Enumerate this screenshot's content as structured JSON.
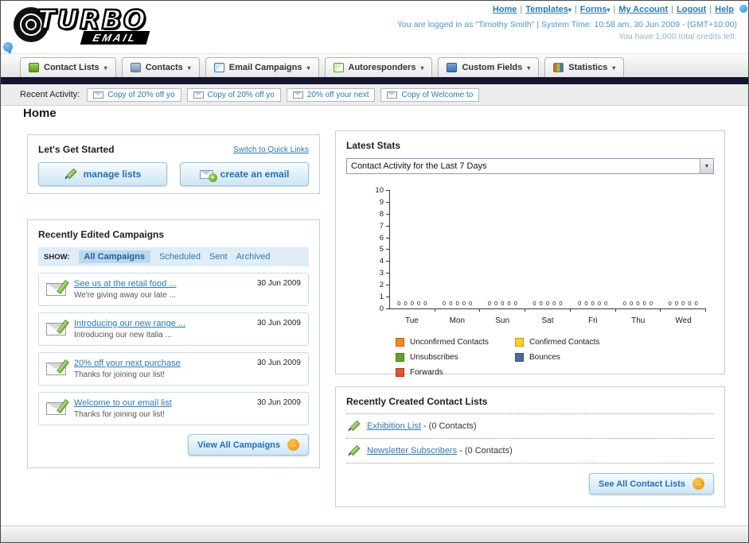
{
  "colors": {
    "link": "#2a7ab8",
    "dark_bar": "#15152e",
    "panel_border": "#b9d2e4",
    "button_text": "#1e6fc0",
    "arrow_badge": "#f49a1c"
  },
  "header": {
    "logo": {
      "line1": "TURBO",
      "line2": "EMAIL"
    },
    "nav": [
      {
        "label": "Home",
        "dropdown": false
      },
      {
        "label": "Templates",
        "dropdown": true
      },
      {
        "label": "Forms",
        "dropdown": true
      },
      {
        "label": "My Account",
        "dropdown": false
      },
      {
        "label": "Logout",
        "dropdown": false
      },
      {
        "label": "Help",
        "dropdown": false
      }
    ],
    "login_info": "You are logged in as \"Timothy Smith\" | System Time: 10:58 am, 30 Jun 2009 - (GMT+10:00)",
    "credits_info": "You have 1,000 total credits left."
  },
  "main_tabs": [
    {
      "label": "Contact Lists",
      "icon": "contact-lists-icon"
    },
    {
      "label": "Contacts",
      "icon": "contacts-icon"
    },
    {
      "label": "Email Campaigns",
      "icon": "email-campaigns-icon"
    },
    {
      "label": "Autoresponders",
      "icon": "autoresponders-icon"
    },
    {
      "label": "Custom Fields",
      "icon": "custom-fields-icon"
    },
    {
      "label": "Statistics",
      "icon": "statistics-icon"
    }
  ],
  "recent_activity": {
    "label": "Recent Activity:",
    "items": [
      "Copy of 20% off yo",
      "Copy of 20% off yo",
      "20% off your next",
      "Copy of Welcome to"
    ]
  },
  "page_title": "Home",
  "get_started": {
    "title": "Let's Get Started",
    "switch_link": "Switch to Quick Links",
    "buttons": [
      {
        "label": "manage lists",
        "icon": "pencil-icon"
      },
      {
        "label": "create an email",
        "icon": "email-plus-icon"
      }
    ]
  },
  "campaigns": {
    "title": "Recently Edited Campaigns",
    "show_label": "SHOW:",
    "filters": [
      "All Campaigns",
      "Scheduled",
      "Sent",
      "Archived"
    ],
    "active_filter": "All Campaigns",
    "items": [
      {
        "title": "See us at the retail food ...",
        "subtitle": "We're giving away our late ...",
        "date": "30 Jun 2009"
      },
      {
        "title": "Introducing our new range ...",
        "subtitle": "Introducing our new Italia ...",
        "date": "30 Jun 2009"
      },
      {
        "title": "20% off your next purchase",
        "subtitle": "Thanks for joining our list!",
        "date": "30 Jun 2009"
      },
      {
        "title": "Welcome to our email list",
        "subtitle": "Thanks for joining our list!",
        "date": "30 Jun 2009"
      }
    ],
    "view_all_label": "View All Campaigns"
  },
  "stats": {
    "title": "Latest Stats",
    "selector_value": "Contact Activity for the Last 7 Days"
  },
  "chart_data": {
    "type": "bar",
    "title": "Contact Activity for the Last 7 Days",
    "categories": [
      "Tue",
      "Mon",
      "Sun",
      "Sat",
      "Fri",
      "Thu",
      "Wed"
    ],
    "series": [
      {
        "name": "Unconfirmed Contacts",
        "color": "#f6891f",
        "values": [
          0,
          0,
          0,
          0,
          0,
          0,
          0
        ]
      },
      {
        "name": "Confirmed Contacts",
        "color": "#fdd01f",
        "values": [
          0,
          0,
          0,
          0,
          0,
          0,
          0
        ]
      },
      {
        "name": "Unsubscribes",
        "color": "#62a625",
        "values": [
          0,
          0,
          0,
          0,
          0,
          0,
          0
        ]
      },
      {
        "name": "Bounces",
        "color": "#4a69a5",
        "values": [
          0,
          0,
          0,
          0,
          0,
          0,
          0
        ]
      },
      {
        "name": "Forwards",
        "color": "#e8502a",
        "values": [
          0,
          0,
          0,
          0,
          0,
          0,
          0
        ]
      }
    ],
    "xlabel": "",
    "ylabel": "",
    "ylim": [
      0,
      10
    ],
    "ytick_step": 1,
    "grid": false,
    "legend_position": "bottom"
  },
  "contact_lists": {
    "title": "Recently Created Contact Lists",
    "items": [
      {
        "name": "Exhibition List",
        "count": "(0 Contacts)"
      },
      {
        "name": "Newsletter Subscribers",
        "count": "(0 Contacts)"
      }
    ],
    "see_all_label": "See All Contact Lists"
  }
}
